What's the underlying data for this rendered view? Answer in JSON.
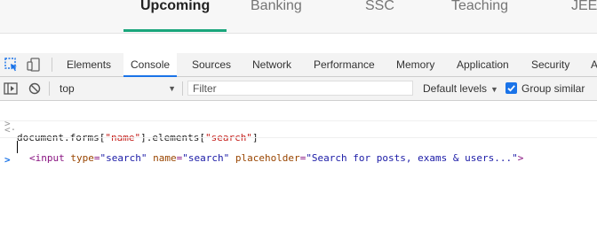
{
  "site_nav": {
    "tabs": [
      {
        "label": "Upcoming",
        "active": true
      },
      {
        "label": "Banking"
      },
      {
        "label": "SSC"
      },
      {
        "label": "Teaching"
      },
      {
        "label": "JEE"
      }
    ],
    "accent": "#1aa67c"
  },
  "devtools": {
    "tabs": [
      "Elements",
      "Console",
      "Sources",
      "Network",
      "Performance",
      "Memory",
      "Application",
      "Security",
      "A"
    ],
    "active_tab": "Console",
    "accent": "#1a73e8"
  },
  "console_toolbar": {
    "context": "top",
    "filter_placeholder": "Filter",
    "levels": "Default levels",
    "group_similar": "Group similar",
    "group_similar_checked": true
  },
  "console": {
    "input_prefix": "document.forms[",
    "input_str1": "\"name\"",
    "input_mid": "].elements[",
    "input_str2": "\"search\"",
    "input_suffix": "]",
    "out_open": "<input ",
    "out_attr1": "type",
    "out_eq1": "=",
    "out_val1": "\"search\"",
    "out_attr2": "name",
    "out_eq2": "=",
    "out_val2": "\"search\"",
    "out_attr3": "placeholder",
    "out_eq3": "=",
    "out_val3": "\"Search for posts, exams & users...\"",
    "out_close": ">",
    "prompt_in": ">",
    "prompt_out": "<·",
    "prompt_active": ">"
  }
}
